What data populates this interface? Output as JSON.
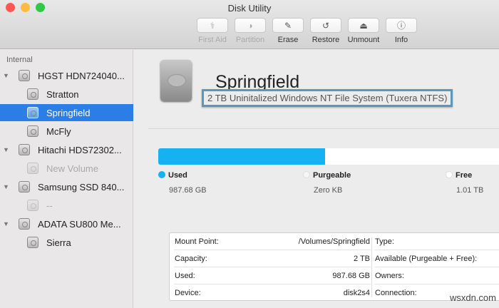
{
  "window": {
    "title": "Disk Utility"
  },
  "traffic_lights": {
    "close": "#fc5753",
    "minimize": "#fdbc40",
    "zoom": "#33c748"
  },
  "toolbar": [
    {
      "label": "First Aid",
      "icon": "⚕",
      "disabled": true
    },
    {
      "label": "Partition",
      "icon": "◑",
      "disabled": true
    },
    {
      "label": "Erase",
      "icon": "✎",
      "disabled": false
    },
    {
      "label": "Restore",
      "icon": "↺",
      "disabled": false
    },
    {
      "label": "Unmount",
      "icon": "⏏",
      "disabled": false
    },
    {
      "label": "Info",
      "icon": "ⓘ",
      "disabled": false
    }
  ],
  "sidebar": {
    "section": "Internal",
    "items": [
      {
        "label": "HGST HDN724040...",
        "level": 0
      },
      {
        "label": "Stratton",
        "level": 1
      },
      {
        "label": "Springfield",
        "level": 1,
        "selected": true
      },
      {
        "label": "McFly",
        "level": 1
      },
      {
        "label": "Hitachi HDS72302...",
        "level": 0
      },
      {
        "label": "New Volume",
        "level": 1,
        "dim": true
      },
      {
        "label": "Samsung SSD 840...",
        "level": 0
      },
      {
        "label": "--",
        "level": 1,
        "dim": true
      },
      {
        "label": "ADATA SU800 Me...",
        "level": 0
      },
      {
        "label": "Sierra",
        "level": 1
      }
    ]
  },
  "volume": {
    "name": "Springfield",
    "description": "2 TB Uninitalized Windows NT File System (Tuxera NTFS)"
  },
  "usage": {
    "used_fraction": 0.49,
    "legend": [
      {
        "label": "Used",
        "value": "987.68 GB",
        "color": "#16b1f0"
      },
      {
        "label": "Purgeable",
        "value": "Zero KB",
        "color": "#f6f6f6"
      },
      {
        "label": "Free",
        "value": "1.01 TB",
        "color": "#ffffff"
      }
    ]
  },
  "info_left": [
    {
      "label": "Mount Point:",
      "value": "/Volumes/Springfield"
    },
    {
      "label": "Capacity:",
      "value": "2 TB"
    },
    {
      "label": "Used:",
      "value": "987.68 GB"
    },
    {
      "label": "Device:",
      "value": "disk2s4"
    }
  ],
  "info_right": [
    {
      "label": "Type:"
    },
    {
      "label": "Available (Purgeable + Free):"
    },
    {
      "label": "Owners:"
    },
    {
      "label": "Connection:"
    }
  ],
  "watermark": "wsxdn.com"
}
